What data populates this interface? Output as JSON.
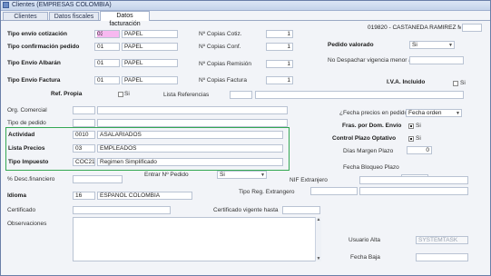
{
  "window": {
    "title": "Clientes (EMPRESAS COLOMBIA)"
  },
  "tabs": [
    {
      "label": "Clientes"
    },
    {
      "label": "Datos fiscales"
    },
    {
      "label": "Datos facturación"
    }
  ],
  "customer": {
    "code_name": "019820 - CASTAÑEDA RAMIREZ MAR"
  },
  "envio": {
    "cotizacion": {
      "label": "Tipo envío cotización",
      "code": "03",
      "name": "PAPEL"
    },
    "confirmacion": {
      "label": "Tipo confirmación pedido",
      "code": "01",
      "name": "PAPEL"
    },
    "albaran": {
      "label": "Tipo Envío Albarán",
      "code": "01",
      "name": "PAPEL"
    },
    "factura": {
      "label": "Tipo Envío Factura",
      "code": "01",
      "name": "PAPEL"
    }
  },
  "copias": {
    "cotiz": {
      "label": "Nº Copias Cotiz.",
      "value": "1"
    },
    "conf": {
      "label": "Nº Copias Conf.",
      "value": "1"
    },
    "remision": {
      "label": "Nº Copias Remisión",
      "value": "1"
    },
    "factura": {
      "label": "Nº Copias Factura",
      "value": "1"
    }
  },
  "pedido_valorado": {
    "label": "Pedido valorado",
    "value": "Si"
  },
  "no_despachar": {
    "label": "No Despachar vigencia menor a:"
  },
  "iva": {
    "label": "I.V.A. Incluido",
    "check_label": "Si"
  },
  "ref_propia": {
    "label": "Ref. Propia",
    "check_label": "Si"
  },
  "lista_referencias": {
    "label": "Lista Referencias"
  },
  "org_comercial": {
    "label": "Org. Comercial"
  },
  "tipo_pedido": {
    "label": "Tipo de pedido"
  },
  "fecha_precios": {
    "label": "¿Fecha precios en pedido?",
    "value": "Fecha orden"
  },
  "fras_dom": {
    "label": "Fras. por Dom. Envío",
    "check_label": "Si"
  },
  "control_plazo": {
    "label": "Control Plazo Optativo",
    "check_label": "Si"
  },
  "dias_margen": {
    "label": "Días Margen Plazo",
    "value": "0"
  },
  "actividad": {
    "label": "Actividad",
    "code": "0010",
    "name": "ASALARIADOS"
  },
  "lista_precios": {
    "label": "Lista Precios",
    "code": "03",
    "name": "EMPLEADOS"
  },
  "tipo_impuesto": {
    "label": "Tipo Impuesto",
    "code": "COC21",
    "name": "Regimen Simplificado"
  },
  "fecha_bloqueo": {
    "label": "Fecha Bloqueo Plazo"
  },
  "desc_financiero": {
    "label": "% Desc.financiero"
  },
  "entrar_pedido": {
    "label": "Entrar Nº Pedido",
    "value": "Si"
  },
  "nif_extranjero": {
    "label": "NIF Extranjero"
  },
  "idioma": {
    "label": "Idioma",
    "code": "16",
    "name": "ESPAÑOL COLOMBIA"
  },
  "tipo_reg_extranjero": {
    "label": "Tipo Reg. Extrangero"
  },
  "certificado": {
    "label": "Certificado"
  },
  "certificado_vigente": {
    "label": "Certificado vigente hasta"
  },
  "observaciones": {
    "label": "Observaciones"
  },
  "usuario_alta": {
    "label": "Usuario Alta",
    "value": "SYSTEMTASK"
  },
  "fecha_baja": {
    "label": "Fecha Baja"
  }
}
